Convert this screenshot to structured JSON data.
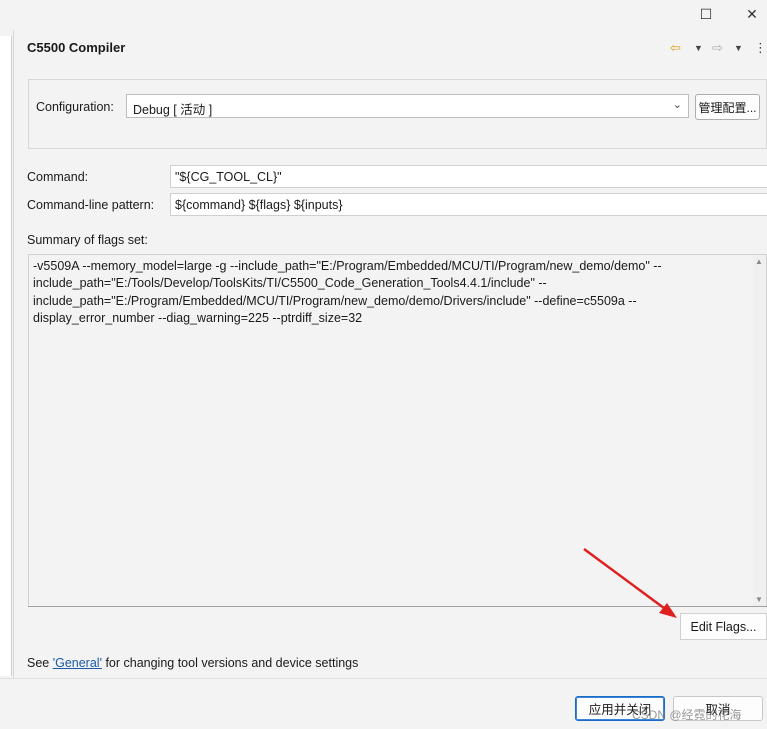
{
  "window": {
    "maximize_glyph": "☐",
    "close_glyph": "✕"
  },
  "header": {
    "title": "C5500 Compiler",
    "back_glyph": "⇦",
    "back_dropdown_glyph": "▼",
    "forward_glyph": "⇨",
    "forward_dropdown_glyph": "▼",
    "menu_glyph": "⋮"
  },
  "configuration": {
    "label": "Configuration:",
    "value": "Debug  [ 活动 ]",
    "chevron_glyph": "⌄",
    "manage_button": "管理配置..."
  },
  "command": {
    "label": "Command:",
    "value": "\"${CG_TOOL_CL}\""
  },
  "pattern": {
    "label": "Command-line pattern:",
    "value": "${command} ${flags} ${inputs}"
  },
  "summary": {
    "label": "Summary of flags set:",
    "text": "-v5509A --memory_model=large -g --include_path=\"E:/Program/Embedded/MCU/TI/Program/new_demo/demo\" --\ninclude_path=\"E:/Tools/Develop/ToolsKits/TI/C5500_Code_Generation_Tools4.4.1/include\" --\ninclude_path=\"E:/Program/Embedded/MCU/TI/Program/new_demo/demo/Drivers/include\" --define=c5509a --\ndisplay_error_number --diag_warning=225 --ptrdiff_size=32",
    "scroll_up_glyph": "▲",
    "scroll_down_glyph": "▼"
  },
  "edit_flags_button": "Edit Flags...",
  "footer_note": {
    "prefix": "See ",
    "link": "'General'",
    "suffix": " for changing tool versions and device settings"
  },
  "buttons": {
    "apply_close": "应用并关闭",
    "cancel": "取消"
  },
  "watermark": "CSDN @经霓的花海",
  "colors": {
    "arrow": "#e02020",
    "link": "#1a5aa8",
    "primary_border": "#1a6bc7",
    "nav_back": "#e0a020"
  }
}
